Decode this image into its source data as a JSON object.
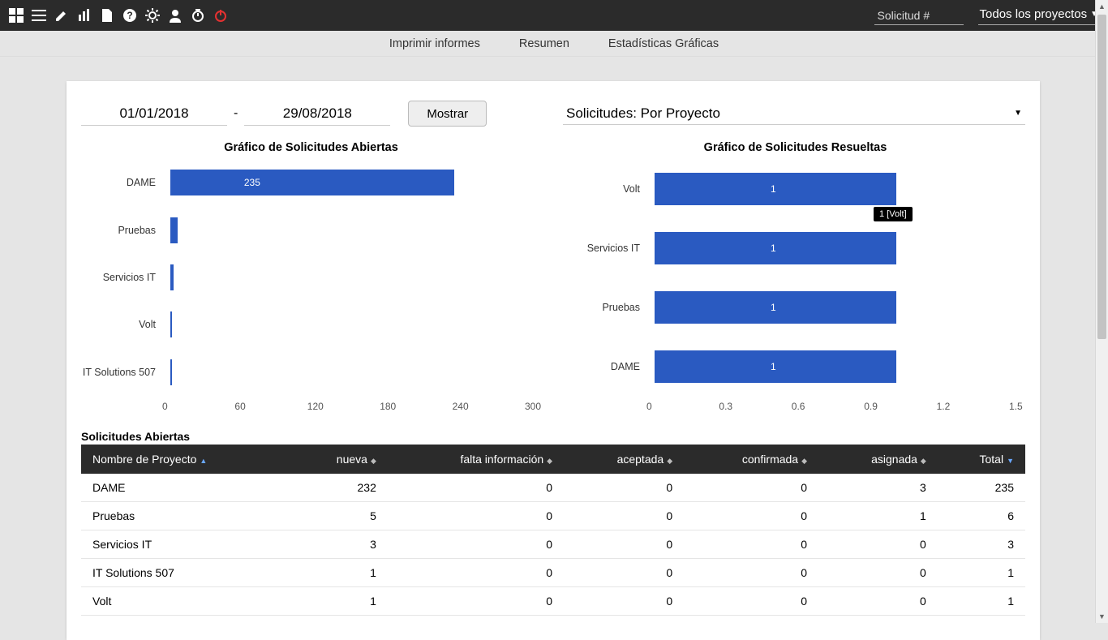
{
  "topbar": {
    "search_placeholder": "Solicitud #",
    "project_selector": "Todos los proyectos"
  },
  "secnav": {
    "print": "Imprimir informes",
    "summary": "Resumen",
    "stats": "Estadísticas Gráficas"
  },
  "filters": {
    "date_from": "01/01/2018",
    "date_to": "29/08/2018",
    "show_label": "Mostrar",
    "select_label": "Solicitudes: Por Proyecto"
  },
  "chart_data": [
    {
      "type": "bar",
      "orientation": "horizontal",
      "title": "Gráfico de Solicitudes Abiertas",
      "categories": [
        "DAME",
        "Pruebas",
        "Servicios IT",
        "Volt",
        "IT Solutions 507"
      ],
      "values": [
        235,
        6,
        3,
        1,
        1
      ],
      "value_labels": [
        "235",
        "",
        "",
        "",
        ""
      ],
      "xticks": [
        0,
        60,
        120,
        180,
        240,
        300
      ],
      "xlim": [
        0,
        300
      ]
    },
    {
      "type": "bar",
      "orientation": "horizontal",
      "title": "Gráfico de Solicitudes Resueltas",
      "categories": [
        "Volt",
        "Servicios IT",
        "Pruebas",
        "DAME"
      ],
      "values": [
        1,
        1,
        1,
        1
      ],
      "value_labels": [
        "1",
        "1",
        "1",
        "1"
      ],
      "xticks": [
        0,
        0.3,
        0.6,
        0.9,
        1.2,
        1.5
      ],
      "xlim": [
        0,
        1.5
      ],
      "tooltip": {
        "text": "1 [Volt]",
        "bar_index": 0
      }
    }
  ],
  "table": {
    "title": "Solicitudes Abiertas",
    "columns": [
      "Nombre de Proyecto",
      "nueva",
      "falta información",
      "aceptada",
      "confirmada",
      "asignada",
      "Total"
    ],
    "rows": [
      {
        "name": "DAME",
        "nueva": 232,
        "falta": 0,
        "aceptada": 0,
        "confirmada": 0,
        "asignada": 3,
        "total": 235
      },
      {
        "name": "Pruebas",
        "nueva": 5,
        "falta": 0,
        "aceptada": 0,
        "confirmada": 0,
        "asignada": 1,
        "total": 6
      },
      {
        "name": "Servicios IT",
        "nueva": 3,
        "falta": 0,
        "aceptada": 0,
        "confirmada": 0,
        "asignada": 0,
        "total": 3
      },
      {
        "name": "IT Solutions 507",
        "nueva": 1,
        "falta": 0,
        "aceptada": 0,
        "confirmada": 0,
        "asignada": 0,
        "total": 1
      },
      {
        "name": "Volt",
        "nueva": 1,
        "falta": 0,
        "aceptada": 0,
        "confirmada": 0,
        "asignada": 0,
        "total": 1
      }
    ]
  }
}
